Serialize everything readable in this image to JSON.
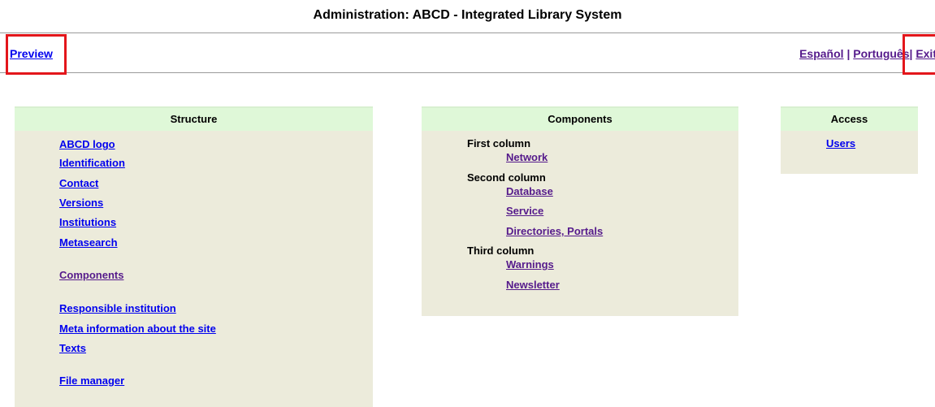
{
  "page_title": "Administration: ABCD - Integrated Library System",
  "topbar": {
    "preview_label": "Preview",
    "languages": [
      "Español",
      "Português"
    ],
    "separator": "|",
    "exit_label": "Exit"
  },
  "structure": {
    "title": "Structure",
    "items": [
      "ABCD logo",
      "Identification",
      "Contact",
      "Versions",
      "Institutions",
      "Metasearch",
      "Components",
      "Responsible institution",
      "Meta information about the site",
      "Texts",
      "File manager"
    ]
  },
  "components": {
    "title": "Components",
    "first_column": {
      "label": "First column",
      "items": [
        "Network"
      ]
    },
    "second_column": {
      "label": "Second column",
      "items": [
        "Database",
        "Service",
        "Directories, Portals"
      ]
    },
    "third_column": {
      "label": "Third column",
      "items": [
        "Warnings",
        "Newsletter"
      ]
    }
  },
  "access": {
    "title": "Access",
    "items": [
      "Users"
    ]
  },
  "colors": {
    "link": "#0000ee",
    "visited_link": "#551a8b",
    "panel_bg": "#ecebdb",
    "panel_header_bg": "#dff8d8",
    "highlight_border": "#e3161b"
  }
}
